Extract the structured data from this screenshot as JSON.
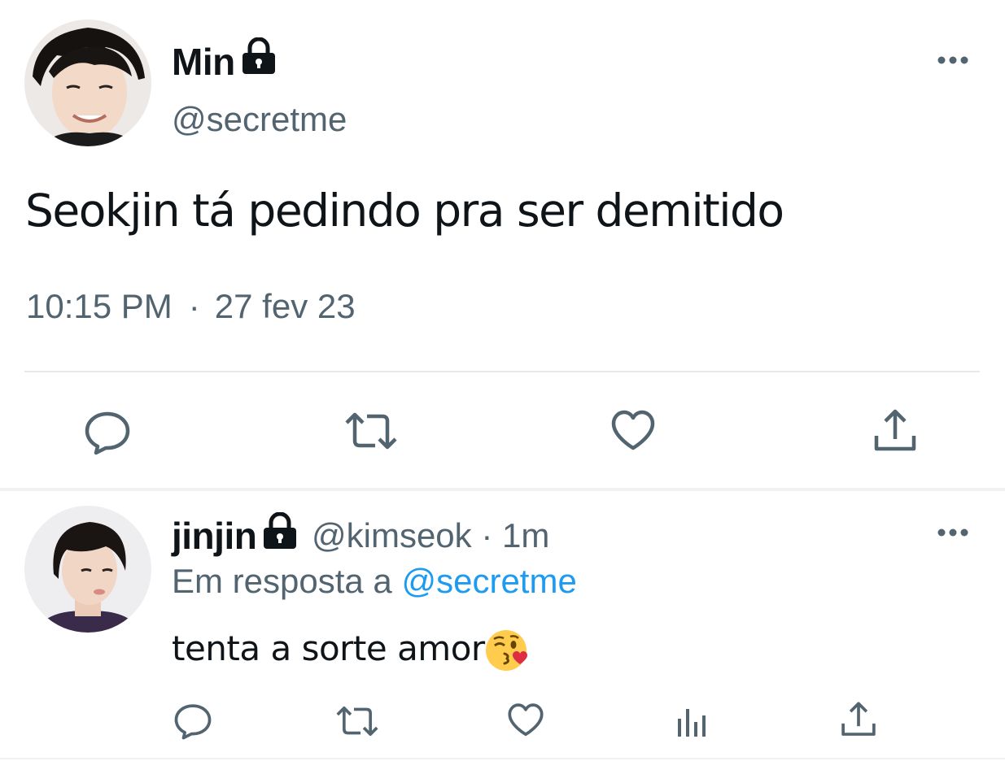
{
  "main_tweet": {
    "display_name": "Min",
    "handle": "@secretme",
    "text": "Seokjin tá pedindo pra ser demitido",
    "time": "10:15 PM",
    "separator": "·",
    "date": "27 fev 23",
    "icons": {
      "lock": "lock-icon",
      "more": "more-icon",
      "reply": "reply-icon",
      "retweet": "retweet-icon",
      "like": "heart-icon",
      "share": "share-icon"
    }
  },
  "reply_tweet": {
    "display_name": "jinjin",
    "handle_meta": "@kimseok · 1m",
    "reply_prefix": "Em resposta a ",
    "reply_mention": "@secretme",
    "text": "tenta a sorte amor",
    "emoji": "face-throwing-a-kiss-emoji",
    "icons": {
      "lock": "lock-icon",
      "more": "more-icon",
      "reply": "reply-icon",
      "retweet": "retweet-icon",
      "like": "heart-icon",
      "views": "views-icon",
      "share": "share-icon"
    }
  },
  "colors": {
    "text_primary": "#0f1419",
    "text_secondary": "#536471",
    "link": "#1d9bf0",
    "divider": "#e6e9eb"
  }
}
